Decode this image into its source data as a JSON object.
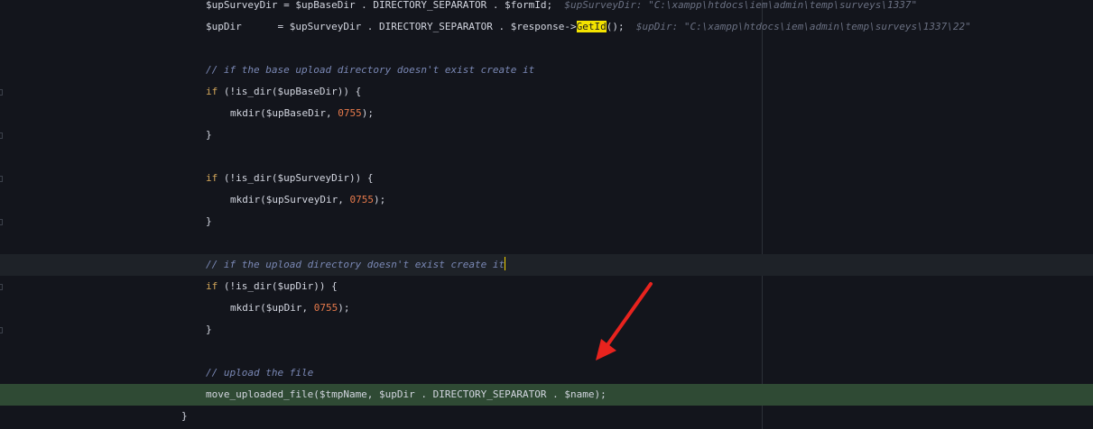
{
  "editor": {
    "lines": [
      {
        "tokens": [
          {
            "t": "$upSurveyDir = $upBaseDir . DIRECTORY_SEPARATOR . $formId;",
            "c": "plain"
          },
          {
            "t": "  $upSurveyDir: \"C:\\xampp\\htdocs\\iem\\admin\\temp\\surveys\\1337\"",
            "c": "hint"
          }
        ]
      },
      {
        "tokens": [
          {
            "t": "$upDir      = $upSurveyDir . DIRECTORY_SEPARATOR . $response->",
            "c": "plain"
          },
          {
            "t": "GetId",
            "c": "hl"
          },
          {
            "t": "();",
            "c": "plain"
          },
          {
            "t": "  $upDir: \"C:\\xampp\\htdocs\\iem\\admin\\temp\\surveys\\1337\\22\"",
            "c": "hint"
          }
        ]
      },
      {
        "tokens": []
      },
      {
        "tokens": [
          {
            "t": "// if the base upload directory doesn't exist create it",
            "c": "cm"
          }
        ]
      },
      {
        "tokens": [
          {
            "t": "if",
            "c": "kw"
          },
          {
            "t": " (!is_dir($upBaseDir)) {",
            "c": "plain"
          }
        ]
      },
      {
        "indent": 1,
        "tokens": [
          {
            "t": "mkdir($upBaseDir, ",
            "c": "plain"
          },
          {
            "t": "0755",
            "c": "num"
          },
          {
            "t": ");",
            "c": "plain"
          }
        ]
      },
      {
        "tokens": [
          {
            "t": "}",
            "c": "plain"
          }
        ]
      },
      {
        "tokens": []
      },
      {
        "tokens": [
          {
            "t": "if",
            "c": "kw"
          },
          {
            "t": " (!is_dir($upSurveyDir)) {",
            "c": "plain"
          }
        ]
      },
      {
        "indent": 1,
        "tokens": [
          {
            "t": "mkdir($upSurveyDir, ",
            "c": "plain"
          },
          {
            "t": "0755",
            "c": "num"
          },
          {
            "t": ");",
            "c": "plain"
          }
        ]
      },
      {
        "tokens": [
          {
            "t": "}",
            "c": "plain"
          }
        ]
      },
      {
        "tokens": []
      },
      {
        "current": true,
        "caret": true,
        "tokens": [
          {
            "t": "// if the upload directory doesn't exist create it",
            "c": "cm"
          }
        ]
      },
      {
        "tokens": [
          {
            "t": "if",
            "c": "kw"
          },
          {
            "t": " (!is_dir($upDir)) {",
            "c": "plain"
          }
        ]
      },
      {
        "indent": 1,
        "tokens": [
          {
            "t": "mkdir($upDir, ",
            "c": "plain"
          },
          {
            "t": "0755",
            "c": "num"
          },
          {
            "t": ");",
            "c": "plain"
          }
        ]
      },
      {
        "tokens": [
          {
            "t": "}",
            "c": "plain"
          }
        ]
      },
      {
        "tokens": []
      },
      {
        "tokens": [
          {
            "t": "// upload the file",
            "c": "cm"
          }
        ]
      },
      {
        "exec": true,
        "tokens": [
          {
            "t": "move_uploaded_file($tmpName, $upDir . DIRECTORY_SEPARATOR . $name);",
            "c": "plain"
          }
        ]
      },
      {
        "outdent": true,
        "tokens": [
          {
            "t": "}",
            "c": "plain"
          }
        ]
      }
    ]
  },
  "colors": {
    "background": "#13151c",
    "current_line": "#1e2228",
    "execution_line": "#2f4a34",
    "keyword": "#d2a65a",
    "number": "#e77a4b",
    "comment": "#7a88b5",
    "inline_hint": "#6a7082",
    "highlight": "#f4e300",
    "annotation_arrow": "#e8231e"
  }
}
